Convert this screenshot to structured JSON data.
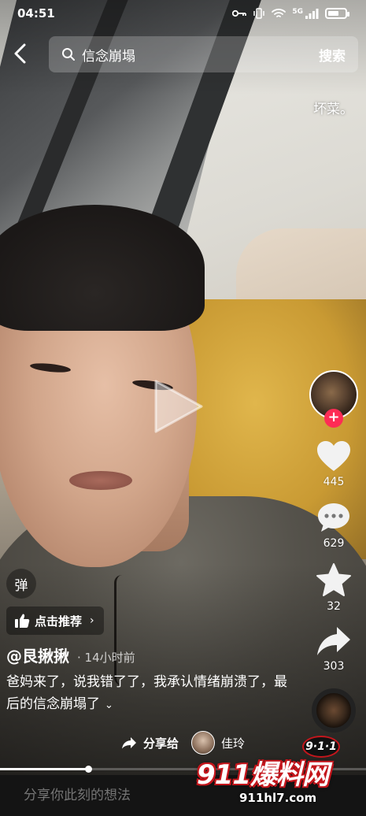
{
  "status_bar": {
    "time": "04:51",
    "network_label": "5G",
    "battery_level": 0.65
  },
  "search": {
    "query": "信念崩塌",
    "button_label": "搜索"
  },
  "corner_tag": "坏菜。",
  "rail": {
    "follow_symbol": "+",
    "likes": "445",
    "comments": "629",
    "favorites": "32",
    "shares": "303"
  },
  "danmu_label": "弹",
  "recommend": {
    "label": "点击推荐",
    "chevron": "›"
  },
  "author": {
    "name": "@艮揪揪",
    "time": "· 14小时前"
  },
  "caption": {
    "text": "爸妈来了，说我错了了，我承认情绪崩溃了，最后的信念崩塌了",
    "expand": "⌄"
  },
  "share_bar": {
    "label": "分享给",
    "target": "佳玲"
  },
  "progress": {
    "fraction": 0.24
  },
  "comment_placeholder": "分享你此刻的想法",
  "watermark": {
    "main": "911爆料网",
    "badge": "9·1·1",
    "url": "911hl7.com"
  },
  "colors": {
    "accent": "#fe2c55",
    "watermark_red": "#c4161c"
  },
  "icons": [
    "back-arrow-icon",
    "search-icon",
    "heart-icon",
    "comment-icon",
    "star-icon",
    "share-arrow-icon",
    "thumbs-up-icon",
    "play-icon",
    "chevron-right-icon"
  ]
}
